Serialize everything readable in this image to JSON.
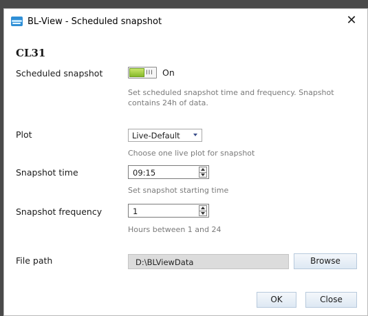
{
  "window": {
    "title": "BL-View - Scheduled snapshot",
    "app_icon": "bl-view-app-icon",
    "close_glyph": "✕"
  },
  "device": {
    "name": "CL31"
  },
  "scheduled_snapshot": {
    "label": "Scheduled snapshot",
    "toggle_grip": "III",
    "state": "On",
    "hint": "Set scheduled snapshot time and frequency. Snapshot contains 24h of data."
  },
  "plot": {
    "label": "Plot",
    "selected": "Live-Default",
    "hint": "Choose one live plot for snapshot"
  },
  "snapshot_time": {
    "label": "Snapshot time",
    "value": "09:15",
    "hint": "Set snapshot starting time"
  },
  "snapshot_frequency": {
    "label": "Snapshot frequency",
    "value": "1",
    "hint": "Hours between 1 and 24"
  },
  "file_path": {
    "label": "File path",
    "value": "D:\\BLViewData",
    "browse_label": "Browse"
  },
  "footer": {
    "ok_label": "OK",
    "close_label": "Close"
  },
  "colors": {
    "toggle_on": "#86b92a",
    "button_border": "#b7c9dc",
    "hint_text": "#7a7a7a"
  }
}
